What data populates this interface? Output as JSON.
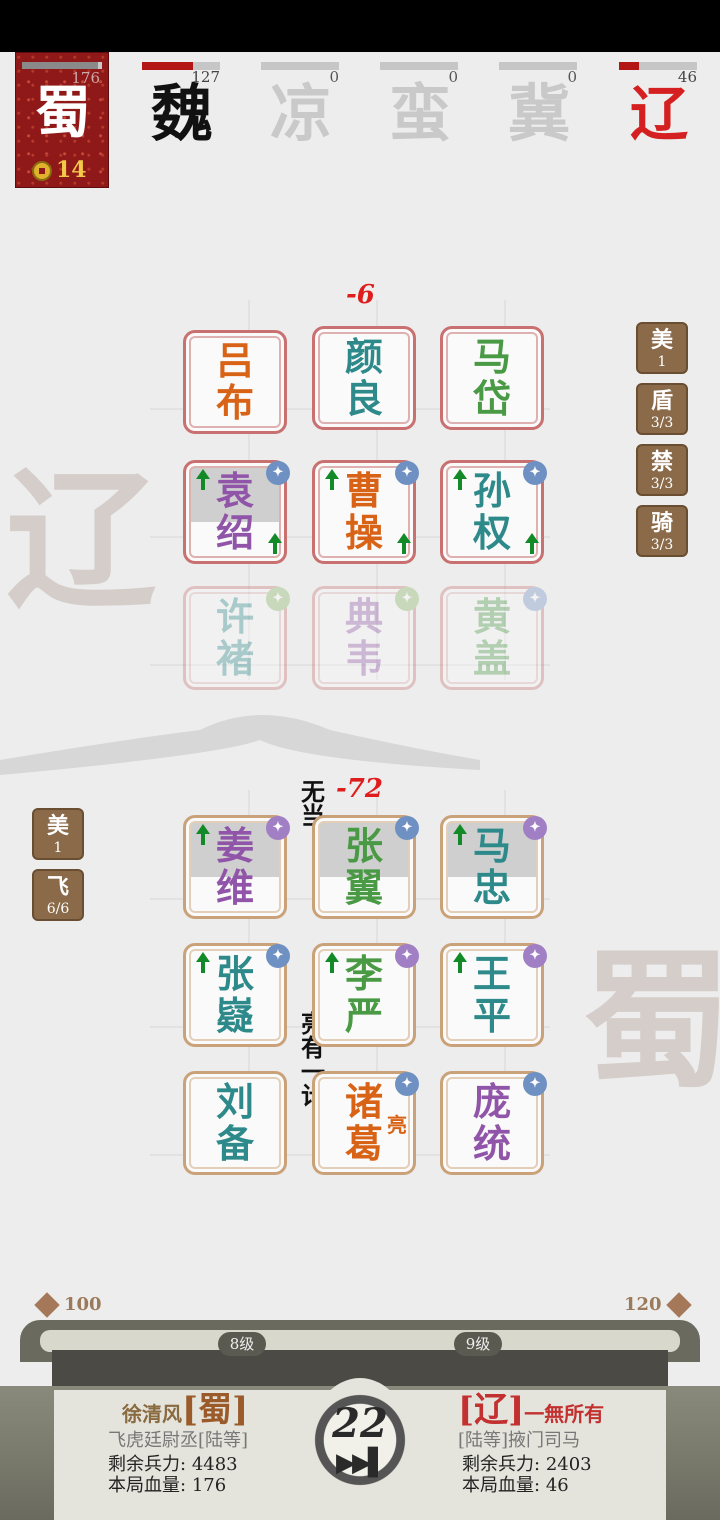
{
  "player_faction": {
    "glyph": "蜀",
    "hp": "176",
    "gold": "14"
  },
  "factions": [
    {
      "glyph": "魏",
      "hp": "127",
      "hp_fraction": 0.65,
      "color": "#111111"
    },
    {
      "glyph": "凉",
      "hp": "0",
      "hp_fraction": 0,
      "color": "#c9c9c9"
    },
    {
      "glyph": "蛮",
      "hp": "0",
      "hp_fraction": 0,
      "color": "#c9c9c9"
    },
    {
      "glyph": "冀",
      "hp": "0",
      "hp_fraction": 0,
      "color": "#c9c9c9"
    },
    {
      "glyph": "辽",
      "hp": "46",
      "hp_fraction": 0.25,
      "color": "#d42020"
    }
  ],
  "enemy_board": {
    "damage": "-6",
    "cells": [
      [
        "吕",
        "布"
      ],
      [
        "颜",
        "良"
      ],
      [
        "马",
        "岱"
      ],
      [
        "袁",
        "绍"
      ],
      [
        "曹",
        "操"
      ],
      [
        "孙",
        "权"
      ],
      [
        "许",
        "褚"
      ],
      [
        "典",
        "韦"
      ],
      [
        "黄",
        "盖"
      ]
    ]
  },
  "ally_board": {
    "damage": "-72",
    "cells": [
      [
        "姜",
        "维"
      ],
      [
        "张",
        "翼"
      ],
      [
        "马",
        "忠"
      ],
      [
        "张",
        "嶷"
      ],
      [
        "李",
        "严"
      ],
      [
        "王",
        "平"
      ],
      [
        "刘",
        "备"
      ],
      [
        "诸",
        "葛"
      ],
      [
        "庞",
        "统"
      ]
    ],
    "liang_mark": "亮"
  },
  "float_texts": [
    "无当",
    "亮有一计"
  ],
  "enemy_tags": [
    {
      "name": "美",
      "value": "1"
    },
    {
      "name": "盾",
      "value": "3/3"
    },
    {
      "name": "禁",
      "value": "3/3"
    },
    {
      "name": "骑",
      "value": "3/3"
    }
  ],
  "ally_tags": [
    {
      "name": "美",
      "value": "1"
    },
    {
      "name": "飞",
      "value": "6/6"
    }
  ],
  "watermarks": {
    "enemy": "辽",
    "ally": "蜀"
  },
  "bottom": {
    "left_gold": "100",
    "right_gold": "120",
    "left_level": "8级",
    "right_level": "9级",
    "timer": "22",
    "left_player": {
      "name": "徐清风",
      "bracket_open": "[",
      "faction": "蜀",
      "bracket_close": "]",
      "title": "飞虎廷尉丞[陆等]",
      "troops_label": "剩余兵力:",
      "troops": "4483",
      "hp_label": "本局血量:",
      "hp": "176"
    },
    "right_player": {
      "bracket_open": "[",
      "faction": "辽",
      "bracket_close": "]",
      "name": "一無所有",
      "title": "[陆等]掖门司马",
      "troops_label": "剩余兵力:",
      "troops": "2403",
      "hp_label": "本局血量:",
      "hp": "46"
    }
  }
}
